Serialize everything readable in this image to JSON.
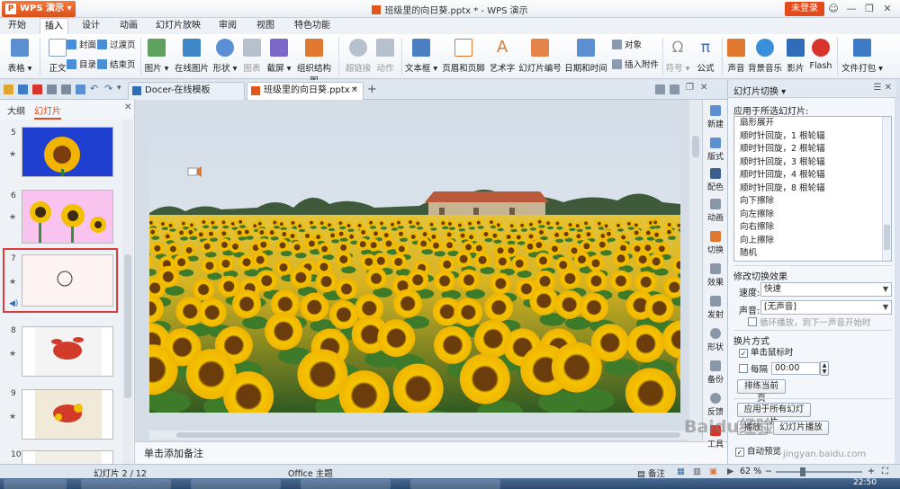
{
  "app": {
    "name": "WPS 演示",
    "window_title": "班级里的向日葵.pptx * - WPS 演示",
    "login_label": "未登录"
  },
  "menu_tabs": [
    "开始",
    "插入",
    "设计",
    "动画",
    "幻灯片放映",
    "审阅",
    "视图",
    "特色功能"
  ],
  "active_menu_tab": "插入",
  "ribbon": {
    "table": "表格",
    "textbox_main": "正文",
    "cover": "封面",
    "toc": "目录",
    "transition_page": "过渡页",
    "end_page": "结束页",
    "picture": "图片",
    "online_picture": "在线图片",
    "shapes": "形状",
    "chart": "图表",
    "screenshot": "截屏",
    "org_chart": "组织结构图",
    "hyperlink": "超链接",
    "action": "动作",
    "text_box": "文本框",
    "header_footer": "页眉和页脚",
    "wordart": "艺术字",
    "slide_number": "幻灯片编号",
    "date_time": "日期和时间",
    "object": "对象",
    "insert_attachment": "插入附件",
    "symbol": "符号",
    "formula": "公式",
    "sound": "声音",
    "bg_music": "背景音乐",
    "movie": "影片",
    "flash": "Flash",
    "package": "文件打包",
    "symbol_glyph": "Ω",
    "formula_glyph": "π"
  },
  "doc_tabs": [
    {
      "label": "Docer-在线模板",
      "active": false
    },
    {
      "label": "班级里的向日葵.pptx *",
      "active": true
    }
  ],
  "left_panel": {
    "tab_outline": "大纲",
    "tab_slides": "幻灯片",
    "thumbnails": [
      {
        "num": "5"
      },
      {
        "num": "6"
      },
      {
        "num": "7"
      },
      {
        "num": "8"
      },
      {
        "num": "9"
      },
      {
        "num": "10"
      }
    ]
  },
  "notes_placeholder": "单击添加备注",
  "rail": [
    "新建",
    "版式",
    "配色",
    "动画",
    "切换",
    "效果",
    "发射",
    "形状",
    "备份",
    "反馈",
    "工具"
  ],
  "task_pane": {
    "title": "幻灯片切换",
    "apply_label": "应用于所选幻灯片:",
    "effects": [
      "扇形展开",
      "顺时针回旋，1 根轮辐",
      "顺时针回旋，2 根轮辐",
      "顺时针回旋，3 根轮辐",
      "顺时针回旋，4 根轮辐",
      "顺时针回旋，8 根轮辐",
      "向下擦除",
      "向左擦除",
      "向右擦除",
      "向上擦除",
      "随机"
    ],
    "modify_label": "修改切换效果",
    "speed_label": "速度:",
    "speed_value": "快速",
    "sound_label": "声音:",
    "sound_value": "[无声音]",
    "loop_label": "循环播放，到下一声音开始时",
    "advance_label": "换片方式",
    "on_click_label": "单击鼠标时",
    "every_label": "每隔",
    "every_value": "00:00",
    "rehearse_label": "排练当前页",
    "apply_all_label": "应用于所有幻灯片",
    "play_label": "播放",
    "slideshow_label": "幻灯片播放",
    "auto_preview_label": "自动预览"
  },
  "status": {
    "slide_count": "幻灯片 2 / 12",
    "theme": "Office 主题",
    "notes_btn": "备注",
    "zoom": "62 %"
  },
  "watermark": {
    "text": "Baidu经验",
    "url": "jingyan.baidu.com"
  },
  "clock": "22:50",
  "colors": {
    "accent": "#d9501a",
    "selection_border": "#e03b3b",
    "sky": "#dde4ec",
    "sunflower": "#f5c400"
  }
}
